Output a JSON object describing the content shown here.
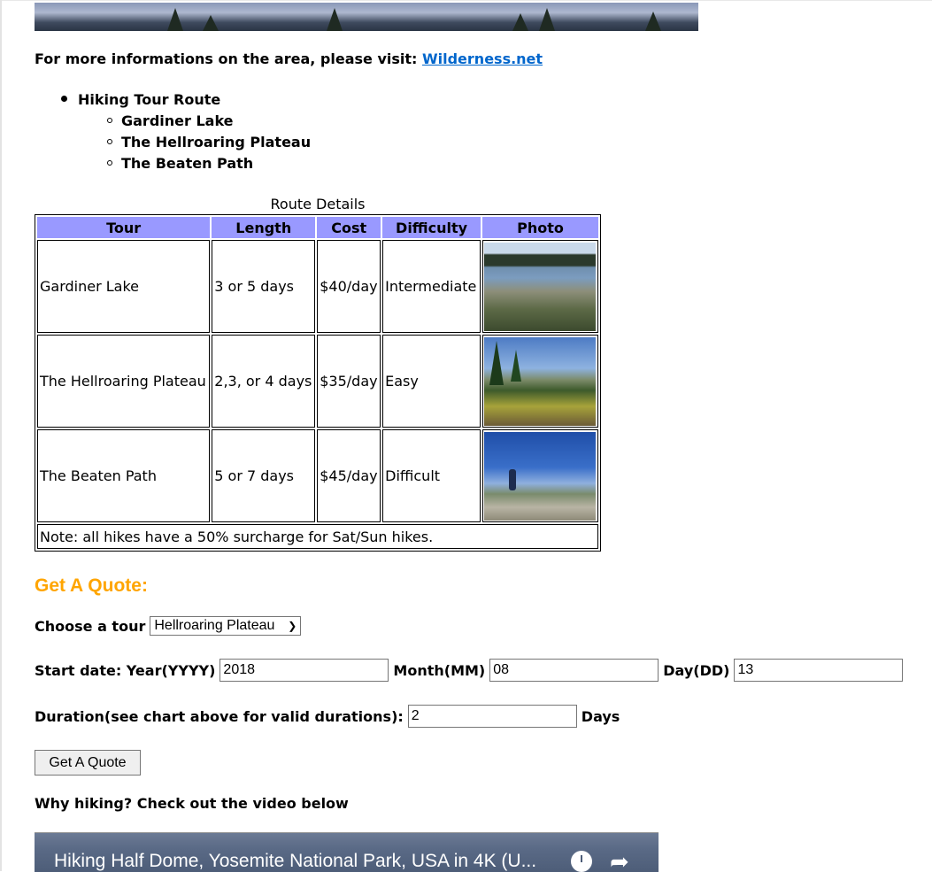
{
  "intro": {
    "text": "For more informations on the area, please visit: ",
    "link_label": "Wilderness.net"
  },
  "route_list": {
    "heading": "Hiking Tour Route",
    "items": [
      "Gardiner Lake",
      "The Hellroaring Plateau",
      "The Beaten Path"
    ]
  },
  "route_table": {
    "caption": "Route Details",
    "headers": [
      "Tour",
      "Length",
      "Cost",
      "Difficulty",
      "Photo"
    ],
    "rows": [
      {
        "tour": "Gardiner Lake",
        "length": "3 or 5 days",
        "cost": "$40/day",
        "difficulty": "Intermediate",
        "photo": "lake-photo"
      },
      {
        "tour": "The Hellroaring Plateau",
        "length": "2,3, or 4 days",
        "cost": "$35/day",
        "difficulty": "Easy",
        "photo": "plateau-photo"
      },
      {
        "tour": "The Beaten Path",
        "length": "5 or 7 days",
        "cost": "$45/day",
        "difficulty": "Difficult",
        "photo": "hiker-photo"
      }
    ],
    "note": "Note: all hikes have a 50% surcharge for Sat/Sun hikes."
  },
  "quote": {
    "heading": "Get A Quote:",
    "tour_label": "Choose a tour",
    "tour_selected": "Hellroaring Plateau",
    "start_label": "Start date: Year(YYYY)",
    "year_value": "2018",
    "month_label": "Month(MM)",
    "month_value": "08",
    "day_label": "Day(DD)",
    "day_value": "13",
    "duration_label": "Duration(see chart above for valid durations):",
    "duration_value": "2",
    "days_label": "Days",
    "button_label": "Get A Quote"
  },
  "video": {
    "prompt": "Why hiking? Check out the video below",
    "title": "Hiking Half Dome, Yosemite National Park, USA in 4K (U..."
  },
  "colors": {
    "header_bg": "#9999ff",
    "link": "#0066cc",
    "quote_heading": "#ffa500"
  }
}
